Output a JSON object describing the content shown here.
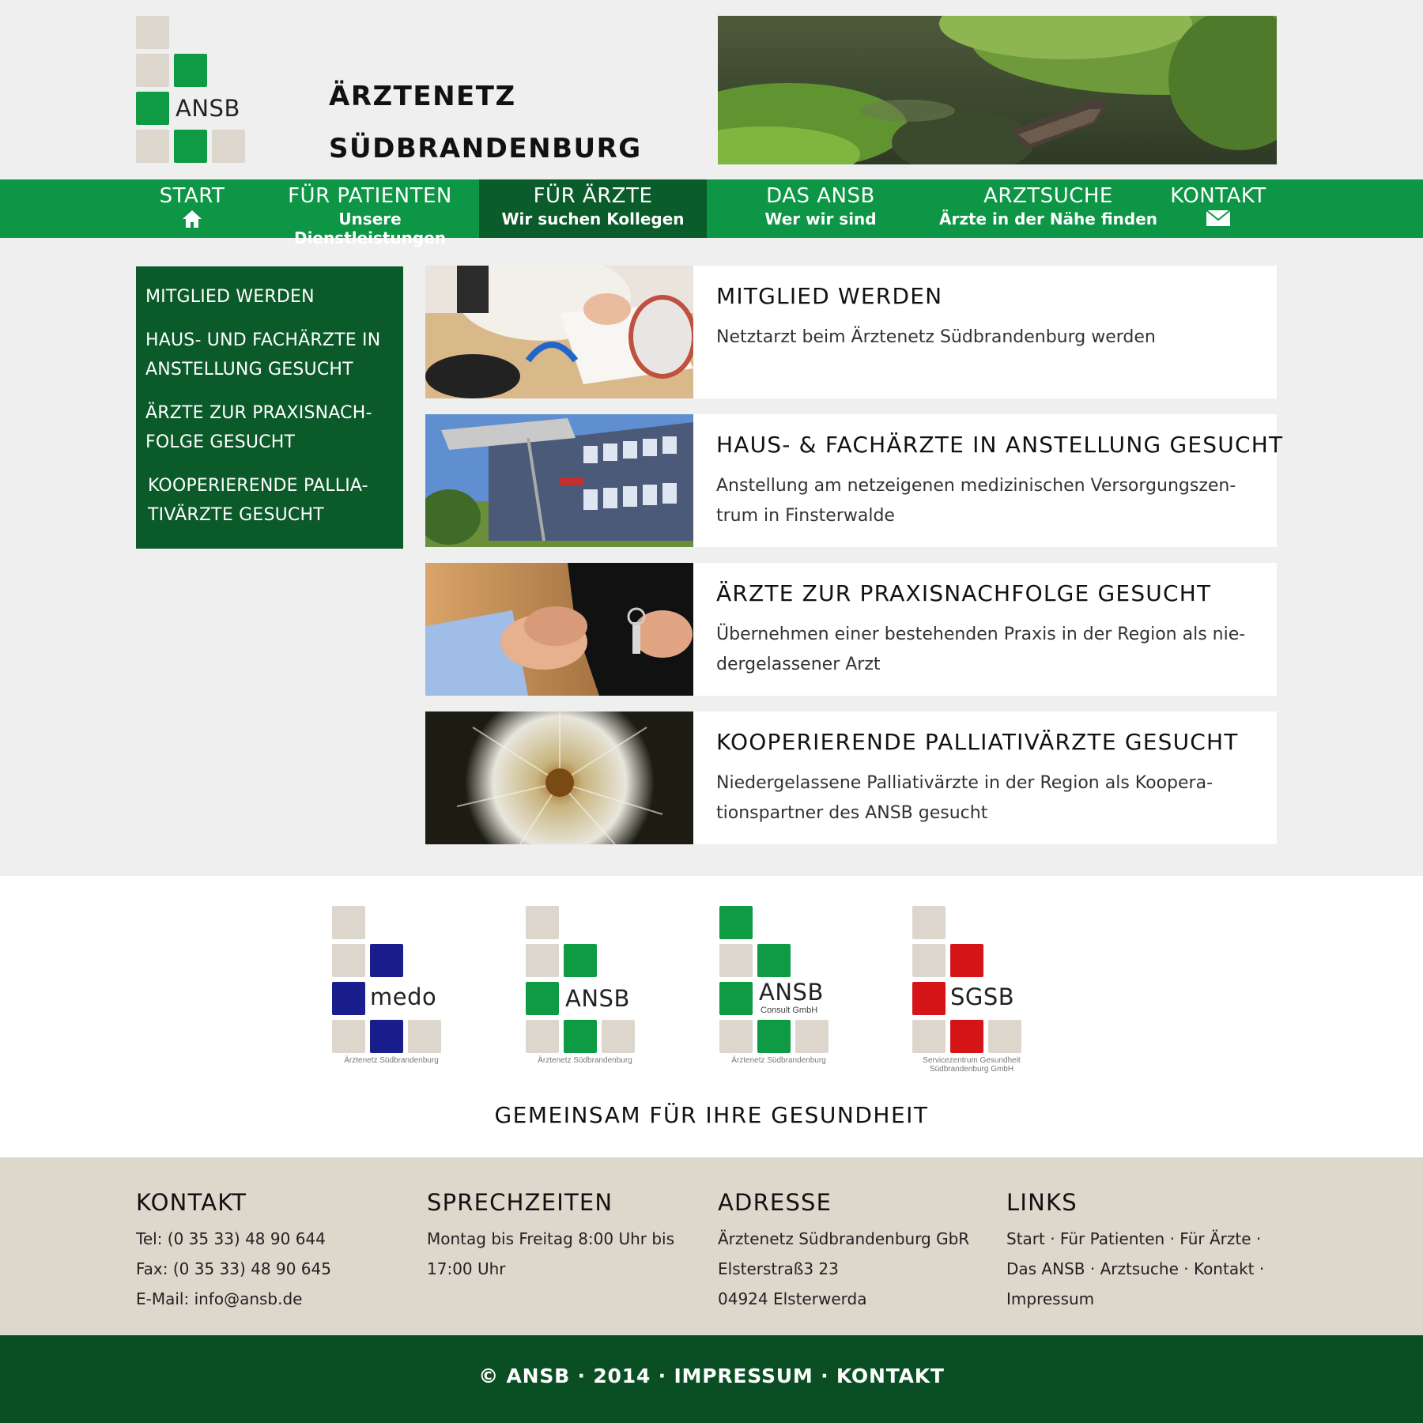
{
  "header": {
    "logo_text": "ANSB",
    "title_line1": "ÄRZTENETZ",
    "title_line2": "SÜDBRANDENBURG"
  },
  "nav": [
    {
      "label": "START",
      "sub": "",
      "icon": "home-icon"
    },
    {
      "label": "FÜR PATIENTEN",
      "sub": "Unsere Dienstleistungen"
    },
    {
      "label": "FÜR ÄRZTE",
      "sub": "Wir suchen Kollegen",
      "active": true
    },
    {
      "label": "DAS ANSB",
      "sub": "Wer wir sind"
    },
    {
      "label": "ARZTSUCHE",
      "sub": "Ärzte in der Nähe finden"
    },
    {
      "label": "KONTAKT",
      "sub": "",
      "icon": "mail-icon"
    }
  ],
  "sidebar": [
    {
      "label": "MITGLIED WERDEN"
    },
    {
      "label": "HAUS- UND FACHÄRZTE IN ANSTELLUNG GESUCHT"
    },
    {
      "label": "ÄRZTE ZUR PRAXISNACH-FOLGE GESUCHT"
    },
    {
      "label": "KOOPERIERENDE PALLIA-TIVÄRZTE GESUCHT"
    }
  ],
  "cards": [
    {
      "title": "MITGLIED WERDEN",
      "text": "Netztarzt beim Ärztenetz Südbrandenburg  werden"
    },
    {
      "title": "HAUS- & FACHÄRZTE IN ANSTELLUNG GESUCHT",
      "text": "Anstellung am netzeigenen medizinischen Versorgungszen-trum in Finsterwalde"
    },
    {
      "title": "ÄRZTE ZUR PRAXISNACHFOLGE GESUCHT",
      "text": "Übernehmen einer bestehenden Praxis in der Region als nie-dergelassener Arzt"
    },
    {
      "title": "KOOPERIERENDE PALLIATIVÄRZTE GESUCHT",
      "text": "Niedergelassene Palliativärzte in der Region als Koopera-tionspartner des ANSB gesucht"
    }
  ],
  "partners": [
    {
      "name": "medo",
      "sub": "",
      "caption": "Ärztenetz Südbrandenburg",
      "color": "#1a1e8c"
    },
    {
      "name": "ANSB",
      "sub": "",
      "caption": "Ärztenetz Südbrandenburg",
      "color": "#0f9a44"
    },
    {
      "name": "ANSB",
      "sub": "Consult GmbH",
      "caption": "Ärztenetz Südbrandenburg",
      "color": "#0f9a44"
    },
    {
      "name": "SGSB",
      "sub": "",
      "caption": "Servicezentrum Gesundheit Südbrandenburg GmbH",
      "color": "#d41416"
    }
  ],
  "slogan": "GEMEINSAM FÜR IHRE GESUNDHEIT",
  "footer": {
    "kontakt": {
      "title": "KONTAKT",
      "lines": [
        "Tel: (0 35 33) 48 90 644",
        "Fax: (0 35 33) 48 90 645",
        "E-Mail: info@ansb.de"
      ]
    },
    "sprechzeiten": {
      "title": "SPRECHZEITEN",
      "lines": [
        "Montag bis Freitag 8:00 Uhr bis",
        "17:00 Uhr"
      ]
    },
    "adresse": {
      "title": "ADRESSE",
      "lines": [
        "Ärztenetz Südbrandenburg GbR",
        "Elsterstraß3 23",
        "04924 Elsterwerda"
      ]
    },
    "links": {
      "title": "LINKS",
      "lines": [
        "Start · Für Patienten · Für Ärzte ·",
        "Das ANSB · Arztsuche · Kontakt ·",
        "Impressum"
      ]
    }
  },
  "bottom": {
    "copyright": "© ANSB",
    "year": "2014",
    "impressum": "IMPRESSUM",
    "kontakt": "KONTAKT",
    "sep": " · "
  },
  "colors": {
    "green": "#0c9645",
    "dark_green": "#0a4f24",
    "beige": "#ddd7cc"
  }
}
